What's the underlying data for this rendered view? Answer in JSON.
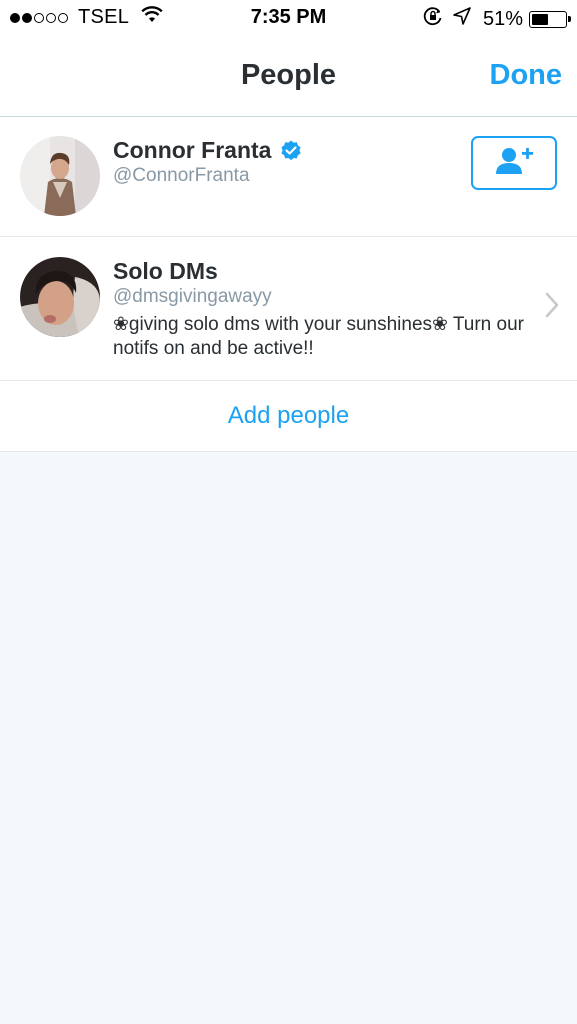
{
  "status_bar": {
    "carrier": "TSEL",
    "time": "7:35 PM",
    "battery": "51%",
    "battery_level": 0.51,
    "signal_bars_filled": 2,
    "signal_bars_total": 5
  },
  "nav": {
    "title": "People",
    "done_label": "Done"
  },
  "people": [
    {
      "name": "Connor Franta",
      "handle": "@ConnorFranta",
      "verified": true
    },
    {
      "name": "Solo DMs",
      "handle": "@dmsgivingawayy",
      "bio": "❀giving solo dms with your sunshines❀ Turn our notifs on and be active!!"
    }
  ],
  "add_people_label": "Add people",
  "colors": {
    "accent": "#1da1f2",
    "background": "#f5f8fa",
    "text": "#292f33",
    "secondary_text": "#8899a6"
  },
  "icons": [
    "wifi-icon",
    "orientation-lock-icon",
    "location-arrow-icon",
    "battery-icon",
    "verified-badge-icon",
    "add-user-icon",
    "chevron-right-icon"
  ]
}
